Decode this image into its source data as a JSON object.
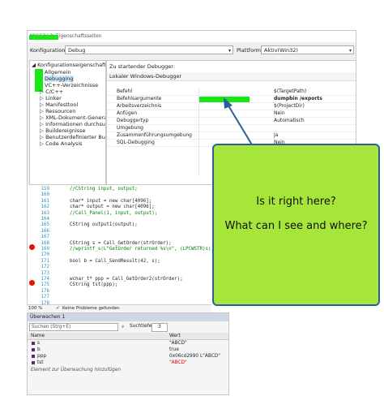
{
  "properties": {
    "title": "MICC3 Lib-Eigenschaftsseiten",
    "config_label": "Konfiguration:",
    "config_value": "Debug",
    "platform_label": "Plattform:",
    "platform_value": "Aktiv(Win32)",
    "tree": [
      "Konfigurationseigenschaften",
      "Allgemein",
      "Debugging",
      "VC++-Verzeichnisse",
      "C/C++",
      "Linker",
      "Manifesttool",
      "Ressourcen",
      "XML-Dokument-Generator",
      "Informationen durchsuchen",
      "Buildereignisse",
      "Benutzerdefinierter Buildschr",
      "Code Analysis"
    ],
    "debugger_to_start": "Zu startender Debugger:",
    "debugger_name": "Lokaler Windows-Debugger",
    "rows": [
      {
        "key": "Befehl",
        "value": "$(TargetPath)"
      },
      {
        "key": "Befehlsargumente",
        "value": "dumpbin /exports"
      },
      {
        "key": "Arbeitsverzeichnis",
        "value": "$(ProjectDir)"
      },
      {
        "key": "Anfügen",
        "value": "Nein"
      },
      {
        "key": "Debuggertyp",
        "value": "Automatisch"
      },
      {
        "key": "Umgebung",
        "value": ""
      },
      {
        "key": "Zusammenführungsumgebung",
        "value": "Ja"
      },
      {
        "key": "SQL-Debugging",
        "value": "Nein"
      }
    ]
  },
  "editor": {
    "lines": [
      {
        "n": "159",
        "code": "//CString input, output;"
      },
      {
        "n": "160",
        "code": ""
      },
      {
        "n": "161",
        "code": "char* input = new char[4096];"
      },
      {
        "n": "162",
        "code": "char* output = new char[4096];"
      },
      {
        "n": "163",
        "code": "//Call_Panel(1, input, output);"
      },
      {
        "n": "164",
        "code": ""
      },
      {
        "n": "165",
        "code": "CString output1(output);"
      },
      {
        "n": "166",
        "code": ""
      },
      {
        "n": "167",
        "code": ""
      },
      {
        "n": "168",
        "code": "CString s = Call_GetOrder(strOrder);"
      },
      {
        "n": "169",
        "code": "//wprintf_s(L\"GetOrder returned %s\\n\", (LPCWSTR)s);"
      },
      {
        "n": "170",
        "code": ""
      },
      {
        "n": "171",
        "code": "bool b = Call_SendResult(42, s);"
      },
      {
        "n": "172",
        "code": ""
      },
      {
        "n": "173",
        "code": ""
      },
      {
        "n": "174",
        "code": "wchar_t* ppp = Call_GetOrder2(strOrder);"
      },
      {
        "n": "175",
        "code": "CString tst(ppp);"
      },
      {
        "n": "176",
        "code": ""
      },
      {
        "n": "177",
        "code": ""
      },
      {
        "n": "178",
        "code": ""
      }
    ],
    "zoom": "100 %",
    "status": "Keine Probleme gefunden"
  },
  "watch": {
    "title": "Überwachen 1",
    "search_placeholder": "Suchen (Strg+E)",
    "search_depth_label": "Suchtiefe:",
    "search_depth": "3",
    "col_name": "Name",
    "col_value": "Wert",
    "rows": [
      {
        "name": "s",
        "value": "\"ABCD\""
      },
      {
        "name": "b",
        "value": "true"
      },
      {
        "name": "ppp",
        "value": "0x06cd2990 L\"ABCD\""
      },
      {
        "name": "tst",
        "value": "\"ABCD\""
      }
    ],
    "add_hint": "Element zur Überwachung hinzufügen"
  },
  "callout": {
    "line1": "Is it right here?",
    "line2": "What can I see and where?"
  },
  "colors": {
    "highlight": "#19e619",
    "callout_fill": "#a6e63b",
    "callout_border": "#2a6099",
    "breakpoint": "#e51400"
  }
}
